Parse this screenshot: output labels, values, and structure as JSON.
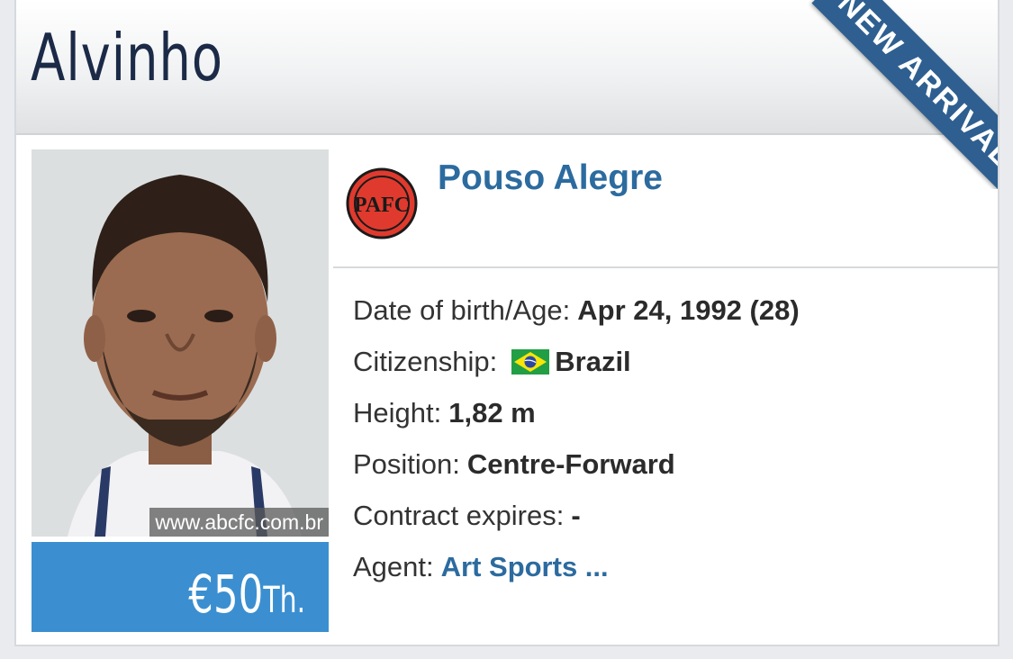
{
  "player": {
    "name": "Alvinho"
  },
  "ribbon": {
    "label": "NEW ARRIVAL"
  },
  "photo": {
    "credit": "www.abcfc.com.br"
  },
  "market_value": {
    "main": "€50",
    "suffix": "Th."
  },
  "club": {
    "name": "Pouso Alegre",
    "logo_text": "PAFC",
    "logo_color": "#e03a2e"
  },
  "facts": [
    {
      "label": "Date of birth/Age:",
      "value": "Apr 24, 1992 (28)"
    },
    {
      "label": "Citizenship:",
      "value": "Brazil",
      "flag": "brazil-flag-icon"
    },
    {
      "label": "Height:",
      "value": "1,82 m"
    },
    {
      "label": "Position:",
      "value": "Centre-Forward"
    },
    {
      "label": "Contract expires:",
      "value": "-"
    },
    {
      "label": "Agent:",
      "value": "Art Sports ...",
      "is_link": true
    }
  ],
  "colors": {
    "accent": "#2c6b9f",
    "value_box": "#3b8fd0",
    "ribbon": "#2e5f90",
    "title": "#1b2a47"
  }
}
